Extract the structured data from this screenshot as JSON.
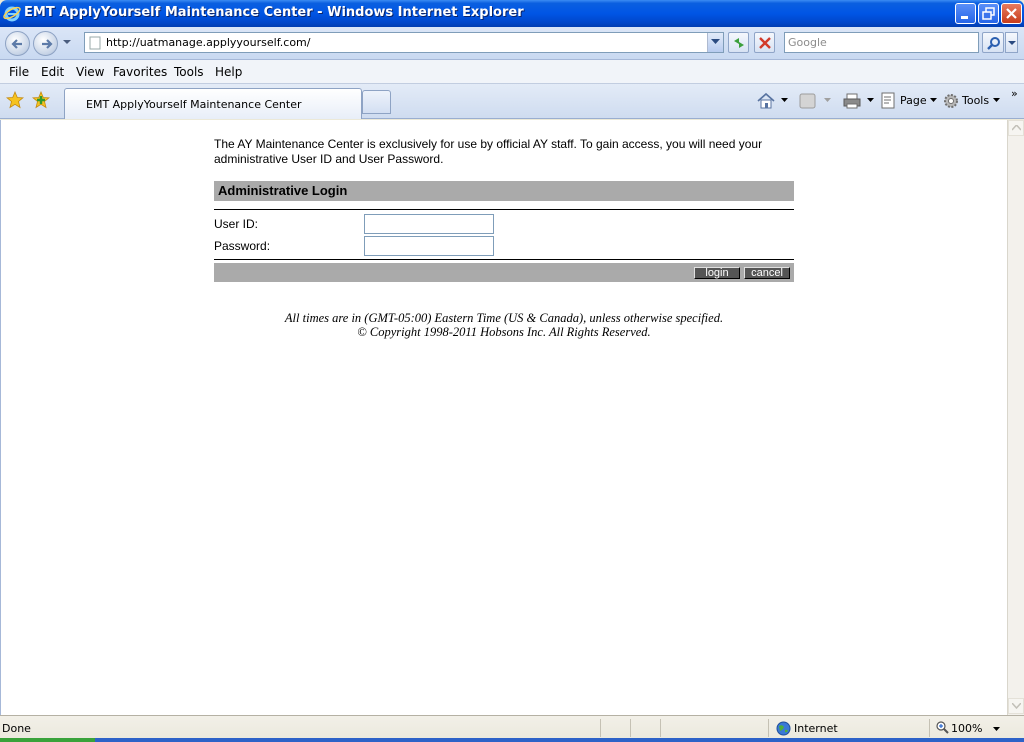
{
  "window": {
    "title": "EMT ApplyYourself Maintenance Center - Windows Internet Explorer"
  },
  "addressbar": {
    "url": "http://uatmanage.applyyourself.com/",
    "search_placeholder": "Google"
  },
  "menu": {
    "items": [
      "File",
      "Edit",
      "View",
      "Favorites",
      "Tools",
      "Help"
    ]
  },
  "tabs": {
    "active_title": "EMT ApplyYourself Maintenance Center"
  },
  "commandbar": {
    "page_label": "Page",
    "tools_label": "Tools"
  },
  "page": {
    "intro_line1": "The AY Maintenance Center is exclusively for use by official AY staff. To gain access, you will need your",
    "intro_line2": "administrative User ID and User Password.",
    "section_title": "Administrative Login",
    "userid_label": "User ID:",
    "password_label": "Password:",
    "userid_value": "",
    "password_value": "",
    "login_label": "login",
    "cancel_label": "cancel",
    "footer_line1": "All times are in (GMT-05:00) Eastern Time (US & Canada), unless otherwise specified.",
    "footer_line2": "© Copyright 1998-2011 Hobsons Inc. All Rights Reserved."
  },
  "statusbar": {
    "status": "Done",
    "zone": "Internet",
    "zoom": "100%"
  },
  "colors": {
    "titlebar": "#0055e5",
    "section_header_bg": "#aaaaaa",
    "button_bg": "#555555"
  }
}
